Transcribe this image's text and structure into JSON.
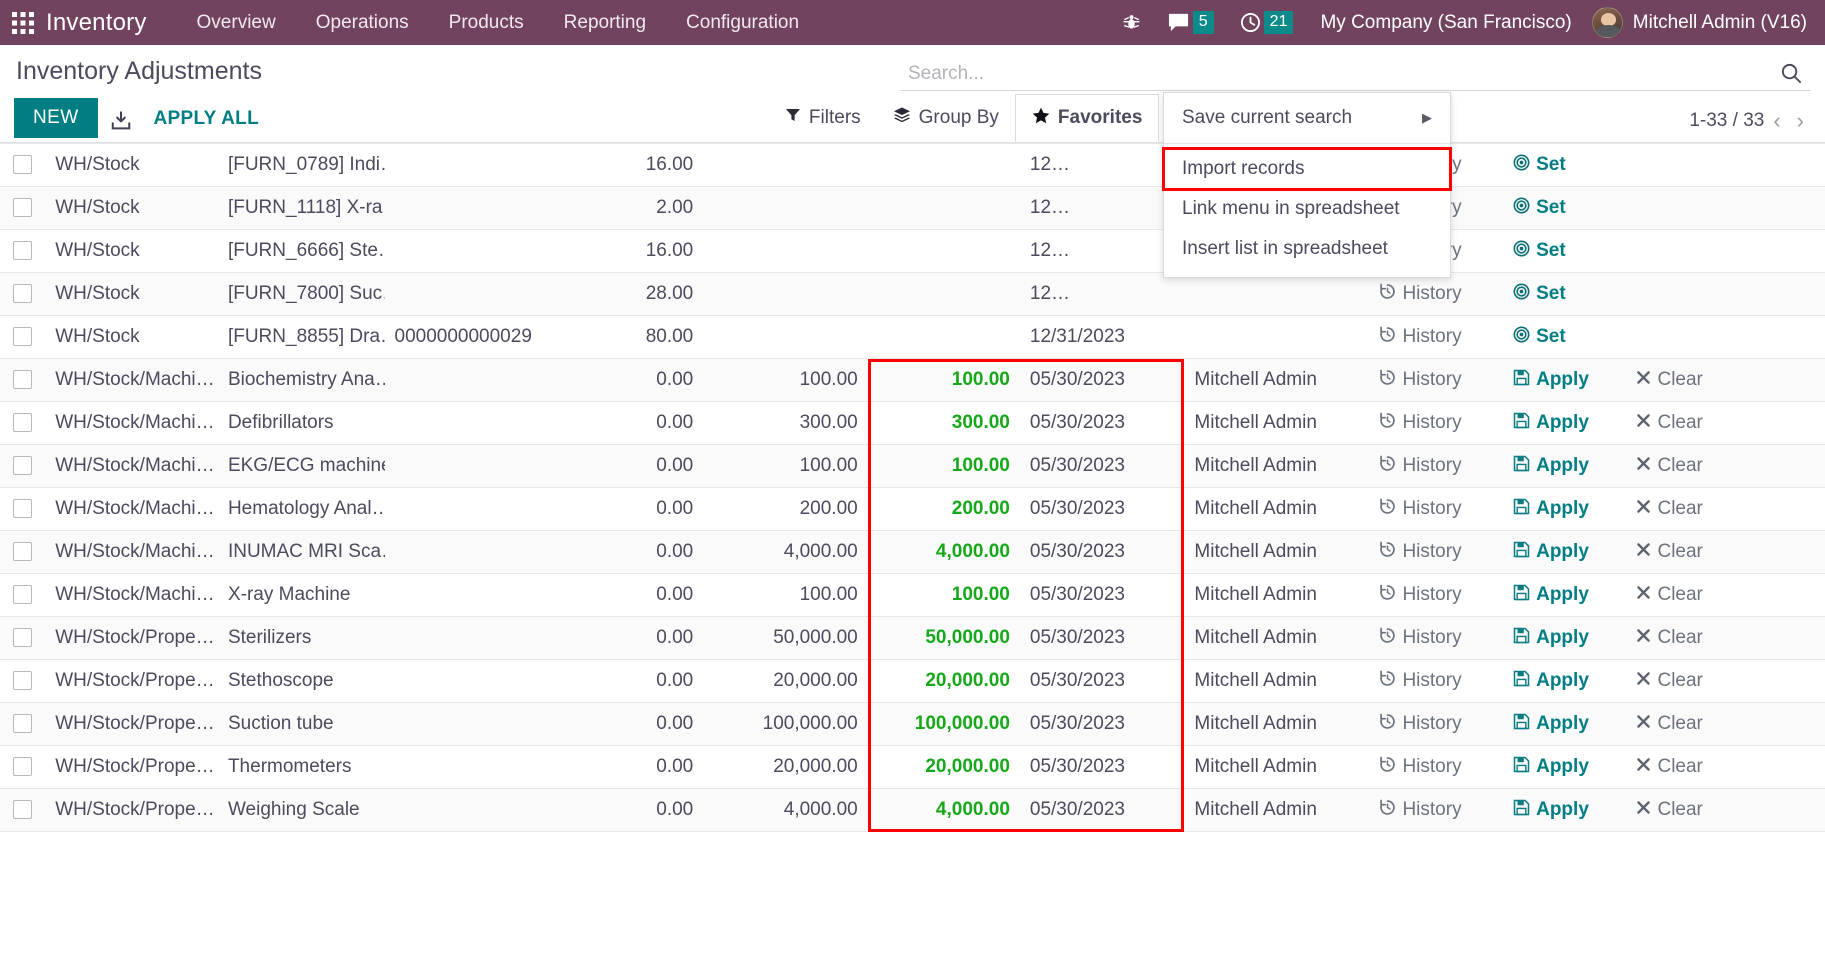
{
  "navbar": {
    "apps_icon": "apps-grid-icon",
    "brand": "Inventory",
    "menu": [
      {
        "label": "Overview"
      },
      {
        "label": "Operations"
      },
      {
        "label": "Products"
      },
      {
        "label": "Reporting"
      },
      {
        "label": "Configuration"
      }
    ],
    "debug_icon": "bug-icon",
    "messages_icon": "chat-bubble-icon",
    "messages_count": "5",
    "activities_icon": "clock-icon",
    "activities_count": "21",
    "company": "My Company (San Francisco)",
    "avatar_icon": "user-avatar",
    "user": "Mitchell Admin (V16)",
    "bg_color": "#71435f",
    "badge_color": "#0d8b8b"
  },
  "control_panel": {
    "title": "Inventory Adjustments",
    "new_label": "NEW",
    "export_icon": "download-icon",
    "apply_all_label": "APPLY ALL",
    "accent_color": "#017e84"
  },
  "search": {
    "placeholder": "Search...",
    "value": "",
    "search_icon": "search-icon"
  },
  "filters_bar": {
    "filters_label": "Filters",
    "filters_icon": "filter-icon",
    "group_by_label": "Group By",
    "group_by_icon": "layers-icon",
    "favorites_label": "Favorites",
    "favorites_icon": "star-icon"
  },
  "pager": {
    "range": "1-33 / 33",
    "prev_icon": "chevron-left-icon",
    "next_icon": "chevron-right-icon"
  },
  "favorites_menu": {
    "items": [
      {
        "label": "Save current search",
        "has_submenu": true,
        "highlighted": false
      },
      {
        "label": "Import records",
        "has_submenu": false,
        "highlighted": true
      },
      {
        "label": "Link menu in spreadsheet",
        "has_submenu": false,
        "highlighted": false
      },
      {
        "label": "Insert list in spreadsheet",
        "has_submenu": false,
        "highlighted": false
      }
    ],
    "highlight_color": "#ff0000"
  },
  "table": {
    "highlight_color": "#ff0000",
    "history_label": "History",
    "history_icon": "history-clock-icon",
    "set_label": "Set",
    "set_icon": "target-circle-icon",
    "apply_label": "Apply",
    "apply_icon": "floppy-save-icon",
    "clear_label": "Clear",
    "clear_icon": "cross-icon",
    "rows": [
      {
        "location": "WH/Stock",
        "product": "[FURN_0789] Indi…",
        "lot": "",
        "on_hand": "16.00",
        "counted": "",
        "difference": "",
        "date": "12…",
        "user": "",
        "actions": "set"
      },
      {
        "location": "WH/Stock",
        "product": "[FURN_1118] X-ra…",
        "lot": "",
        "on_hand": "2.00",
        "counted": "",
        "difference": "",
        "date": "12…",
        "user": "",
        "actions": "set"
      },
      {
        "location": "WH/Stock",
        "product": "[FURN_6666] Ste…",
        "lot": "",
        "on_hand": "16.00",
        "counted": "",
        "difference": "",
        "date": "12…",
        "user": "",
        "actions": "set"
      },
      {
        "location": "WH/Stock",
        "product": "[FURN_7800] Suc…",
        "lot": "",
        "on_hand": "28.00",
        "counted": "",
        "difference": "",
        "date": "12…",
        "user": "",
        "actions": "set"
      },
      {
        "location": "WH/Stock",
        "product": "[FURN_8855] Dra…",
        "lot": "0000000000029",
        "on_hand": "80.00",
        "counted": "",
        "difference": "",
        "date": "12/31/2023",
        "user": "",
        "actions": "set"
      },
      {
        "location": "WH/Stock/Machi…",
        "product": "Biochemistry Ana…",
        "lot": "",
        "on_hand": "0.00",
        "counted": "100.00",
        "difference": "100.00",
        "date": "05/30/2023",
        "user": "Mitchell Admin",
        "actions": "apply"
      },
      {
        "location": "WH/Stock/Machi…",
        "product": "Defibrillators",
        "lot": "",
        "on_hand": "0.00",
        "counted": "300.00",
        "difference": "300.00",
        "date": "05/30/2023",
        "user": "Mitchell Admin",
        "actions": "apply"
      },
      {
        "location": "WH/Stock/Machi…",
        "product": "EKG/ECG machines,",
        "lot": "",
        "on_hand": "0.00",
        "counted": "100.00",
        "difference": "100.00",
        "date": "05/30/2023",
        "user": "Mitchell Admin",
        "actions": "apply"
      },
      {
        "location": "WH/Stock/Machi…",
        "product": "Hematology Anal…",
        "lot": "",
        "on_hand": "0.00",
        "counted": "200.00",
        "difference": "200.00",
        "date": "05/30/2023",
        "user": "Mitchell Admin",
        "actions": "apply"
      },
      {
        "location": "WH/Stock/Machi…",
        "product": "INUMAC MRI Sca…",
        "lot": "",
        "on_hand": "0.00",
        "counted": "4,000.00",
        "difference": "4,000.00",
        "date": "05/30/2023",
        "user": "Mitchell Admin",
        "actions": "apply"
      },
      {
        "location": "WH/Stock/Machi…",
        "product": "X-ray Machine",
        "lot": "",
        "on_hand": "0.00",
        "counted": "100.00",
        "difference": "100.00",
        "date": "05/30/2023",
        "user": "Mitchell Admin",
        "actions": "apply"
      },
      {
        "location": "WH/Stock/Prope…",
        "product": "Sterilizers",
        "lot": "",
        "on_hand": "0.00",
        "counted": "50,000.00",
        "difference": "50,000.00",
        "date": "05/30/2023",
        "user": "Mitchell Admin",
        "actions": "apply"
      },
      {
        "location": "WH/Stock/Prope…",
        "product": "Stethoscope",
        "lot": "",
        "on_hand": "0.00",
        "counted": "20,000.00",
        "difference": "20,000.00",
        "date": "05/30/2023",
        "user": "Mitchell Admin",
        "actions": "apply"
      },
      {
        "location": "WH/Stock/Prope…",
        "product": "Suction tube",
        "lot": "",
        "on_hand": "0.00",
        "counted": "100,000.00",
        "difference": "100,000.00",
        "date": "05/30/2023",
        "user": "Mitchell Admin",
        "actions": "apply"
      },
      {
        "location": "WH/Stock/Prope…",
        "product": "Thermometers",
        "lot": "",
        "on_hand": "0.00",
        "counted": "20,000.00",
        "difference": "20,000.00",
        "date": "05/30/2023",
        "user": "Mitchell Admin",
        "actions": "apply"
      },
      {
        "location": "WH/Stock/Prope…",
        "product": "Weighing Scale",
        "lot": "",
        "on_hand": "0.00",
        "counted": "4,000.00",
        "difference": "4,000.00",
        "date": "05/30/2023",
        "user": "Mitchell Admin",
        "actions": "apply"
      }
    ]
  }
}
